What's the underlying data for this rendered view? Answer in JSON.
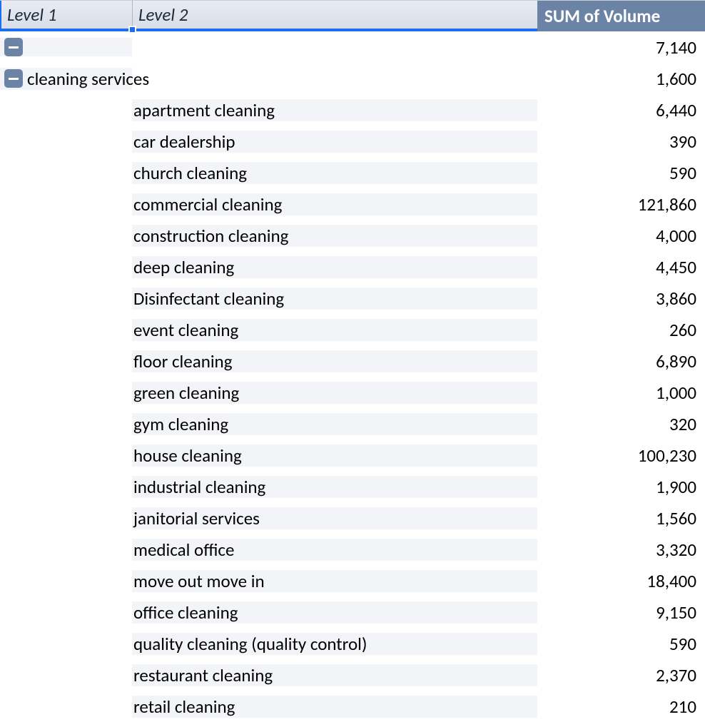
{
  "header": {
    "level1": "Level 1",
    "level2": "Level 2",
    "sum": "SUM of Volume"
  },
  "rows": [
    {
      "collapse": true,
      "level1": "",
      "level2": "",
      "value": "7,140"
    },
    {
      "collapse": true,
      "level1": "cleaning services",
      "level2": "",
      "value": "1,600"
    },
    {
      "collapse": false,
      "level1": "",
      "level2": "apartment cleaning",
      "value": "6,440"
    },
    {
      "collapse": false,
      "level1": "",
      "level2": "car dealership",
      "value": "390"
    },
    {
      "collapse": false,
      "level1": "",
      "level2": "church cleaning",
      "value": "590"
    },
    {
      "collapse": false,
      "level1": "",
      "level2": "commercial cleaning",
      "value": "121,860"
    },
    {
      "collapse": false,
      "level1": "",
      "level2": "construction cleaning",
      "value": "4,000"
    },
    {
      "collapse": false,
      "level1": "",
      "level2": "deep cleaning",
      "value": "4,450"
    },
    {
      "collapse": false,
      "level1": "",
      "level2": "Disinfectant cleaning",
      "value": "3,860"
    },
    {
      "collapse": false,
      "level1": "",
      "level2": "event cleaning",
      "value": "260"
    },
    {
      "collapse": false,
      "level1": "",
      "level2": "floor cleaning",
      "value": "6,890"
    },
    {
      "collapse": false,
      "level1": "",
      "level2": "green cleaning",
      "value": "1,000"
    },
    {
      "collapse": false,
      "level1": "",
      "level2": "gym cleaning",
      "value": "320"
    },
    {
      "collapse": false,
      "level1": "",
      "level2": "house cleaning",
      "value": "100,230"
    },
    {
      "collapse": false,
      "level1": "",
      "level2": "industrial cleaning",
      "value": "1,900"
    },
    {
      "collapse": false,
      "level1": "",
      "level2": "janitorial services",
      "value": "1,560"
    },
    {
      "collapse": false,
      "level1": "",
      "level2": "medical office",
      "value": "3,320"
    },
    {
      "collapse": false,
      "level1": "",
      "level2": "move out move in",
      "value": "18,400"
    },
    {
      "collapse": false,
      "level1": "",
      "level2": "office cleaning",
      "value": "9,150"
    },
    {
      "collapse": false,
      "level1": "",
      "level2": "quality cleaning (quality control)",
      "value": "590"
    },
    {
      "collapse": false,
      "level1": "",
      "level2": "restaurant cleaning",
      "value": "2,370"
    },
    {
      "collapse": false,
      "level1": "",
      "level2": "retail cleaning",
      "value": "210"
    }
  ]
}
